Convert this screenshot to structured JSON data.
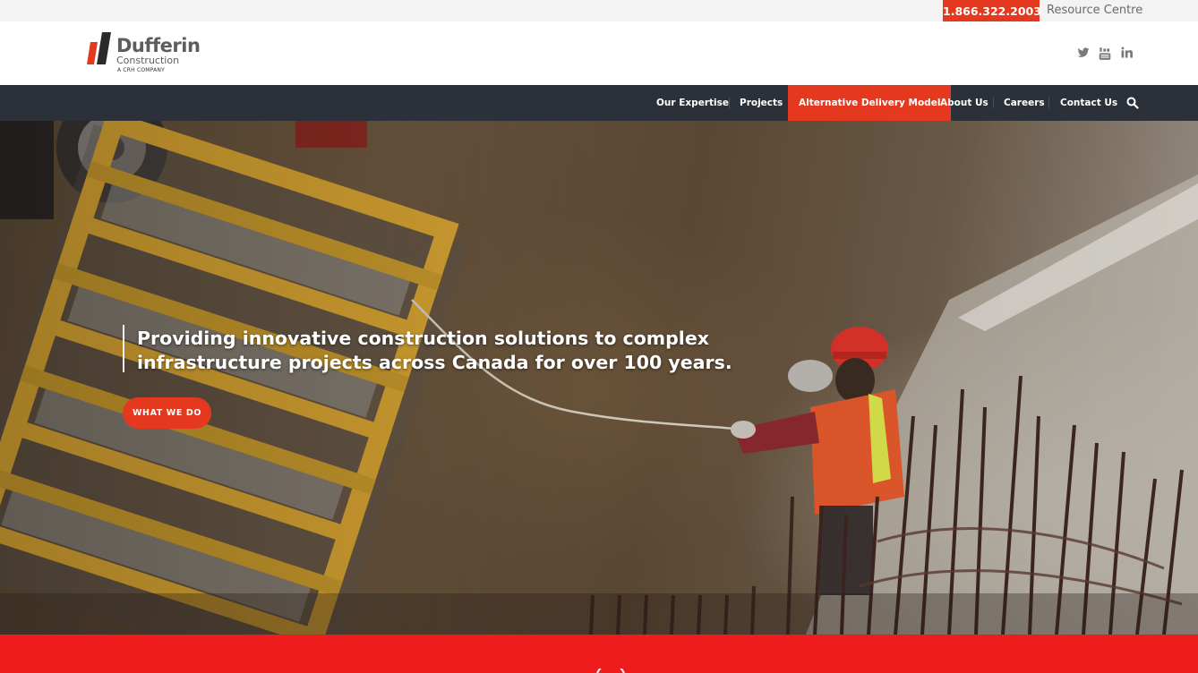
{
  "utility": {
    "phone": "1.866.322.2003",
    "resource_centre": "Resource Centre"
  },
  "logo": {
    "name": "Dufferin",
    "sub": "Construction",
    "tag": "A CRH COMPANY"
  },
  "social": [
    "twitter-icon",
    "youtube-icon",
    "linkedin-icon"
  ],
  "nav": {
    "items": [
      {
        "label": "Our Expertise"
      },
      {
        "label": "Projects"
      },
      {
        "label": "Alternative Delivery Model",
        "active": true
      },
      {
        "label": "About Us"
      },
      {
        "label": "Careers"
      },
      {
        "label": "Contact Us"
      }
    ],
    "search_icon": "search-icon"
  },
  "hero": {
    "tagline": "Providing innovative construction solutions to complex infrastructure projects across Canada for over 100 years.",
    "cta_label": "WHAT WE DO"
  },
  "colors": {
    "accent": "#e5391f",
    "nav_bg": "#2b3039",
    "band": "#ee1c1c"
  }
}
